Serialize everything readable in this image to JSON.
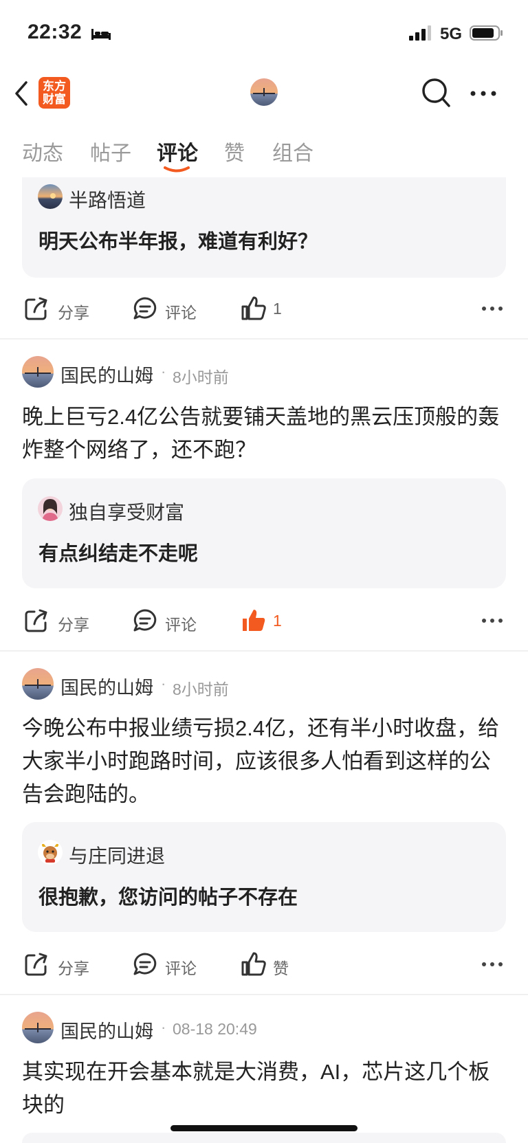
{
  "status": {
    "time": "22:32",
    "network": "5G",
    "bed_icon": "bed-icon",
    "signal_icon": "signal-bars-icon",
    "battery_icon": "battery-icon"
  },
  "nav": {
    "logo_line1": "东方",
    "logo_line2": "财富",
    "back_icon": "chevron-left-icon",
    "search_icon": "search-icon",
    "more_icon": "more-horizontal-icon"
  },
  "tabs": [
    {
      "label": "动态",
      "active": false
    },
    {
      "label": "帖子",
      "active": false
    },
    {
      "label": "评论",
      "active": true
    },
    {
      "label": "赞",
      "active": false
    },
    {
      "label": "组合",
      "active": false
    }
  ],
  "colors": {
    "accent": "#f25a1f",
    "card_bg": "#f5f5f7",
    "muted": "#999999"
  },
  "feed": [
    {
      "quoted": {
        "author": "半路悟道",
        "text": "明天公布半年报，难道有利好？"
      },
      "actions": {
        "share": "分享",
        "comment": "评论",
        "like": "1",
        "liked": false
      }
    },
    {
      "author": "国民的山姆",
      "time": "8小时前",
      "text": "晚上巨亏2.4亿公告就要铺天盖地的黑云压顶般的轰炸整个网络了，还不跑？",
      "quoted": {
        "author": "独自享受财富",
        "text": "有点纠结走不走呢"
      },
      "actions": {
        "share": "分享",
        "comment": "评论",
        "like": "1",
        "liked": true
      }
    },
    {
      "author": "国民的山姆",
      "time": "8小时前",
      "text": "今晚公布中报业绩亏损2.4亿，还有半小时收盘，给大家半小时跑路时间，应该很多人怕看到这样的公告会跑陆的。",
      "quoted": {
        "author": "与庄同进退",
        "text": "很抱歉，您访问的帖子不存在"
      },
      "actions": {
        "share": "分享",
        "comment": "评论",
        "like": "赞",
        "liked": false
      }
    },
    {
      "author": "国民的山姆",
      "time": "08-18 20:49",
      "text": "其实现在开会基本就是大消费，AI，芯片这几个板块的"
    }
  ]
}
